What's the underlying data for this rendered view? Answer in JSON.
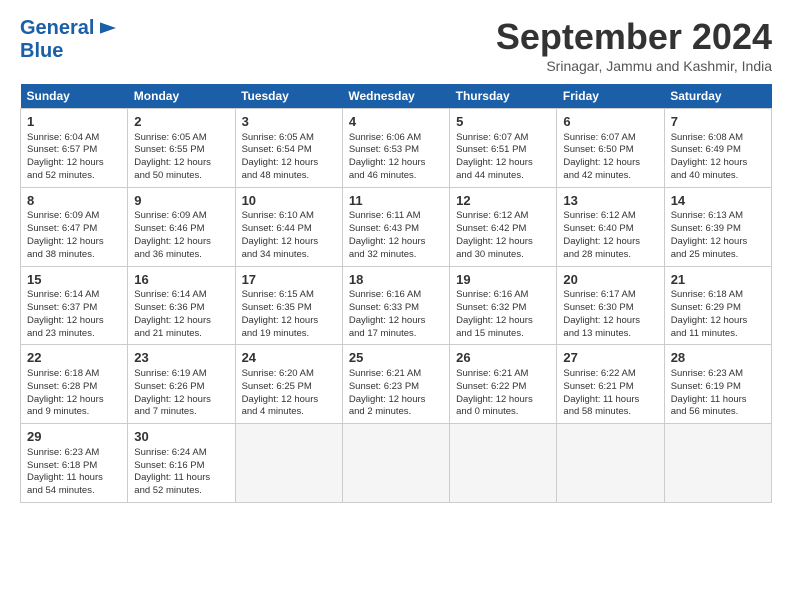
{
  "logo": {
    "line1": "General",
    "line2": "Blue"
  },
  "title": "September 2024",
  "subtitle": "Srinagar, Jammu and Kashmir, India",
  "days_header": [
    "Sunday",
    "Monday",
    "Tuesday",
    "Wednesday",
    "Thursday",
    "Friday",
    "Saturday"
  ],
  "weeks": [
    [
      {
        "num": "1",
        "rise": "6:04 AM",
        "set": "6:57 PM",
        "daylight": "12 hours and 52 minutes."
      },
      {
        "num": "2",
        "rise": "6:05 AM",
        "set": "6:55 PM",
        "daylight": "12 hours and 50 minutes."
      },
      {
        "num": "3",
        "rise": "6:05 AM",
        "set": "6:54 PM",
        "daylight": "12 hours and 48 minutes."
      },
      {
        "num": "4",
        "rise": "6:06 AM",
        "set": "6:53 PM",
        "daylight": "12 hours and 46 minutes."
      },
      {
        "num": "5",
        "rise": "6:07 AM",
        "set": "6:51 PM",
        "daylight": "12 hours and 44 minutes."
      },
      {
        "num": "6",
        "rise": "6:07 AM",
        "set": "6:50 PM",
        "daylight": "12 hours and 42 minutes."
      },
      {
        "num": "7",
        "rise": "6:08 AM",
        "set": "6:49 PM",
        "daylight": "12 hours and 40 minutes."
      }
    ],
    [
      {
        "num": "8",
        "rise": "6:09 AM",
        "set": "6:47 PM",
        "daylight": "12 hours and 38 minutes."
      },
      {
        "num": "9",
        "rise": "6:09 AM",
        "set": "6:46 PM",
        "daylight": "12 hours and 36 minutes."
      },
      {
        "num": "10",
        "rise": "6:10 AM",
        "set": "6:44 PM",
        "daylight": "12 hours and 34 minutes."
      },
      {
        "num": "11",
        "rise": "6:11 AM",
        "set": "6:43 PM",
        "daylight": "12 hours and 32 minutes."
      },
      {
        "num": "12",
        "rise": "6:12 AM",
        "set": "6:42 PM",
        "daylight": "12 hours and 30 minutes."
      },
      {
        "num": "13",
        "rise": "6:12 AM",
        "set": "6:40 PM",
        "daylight": "12 hours and 28 minutes."
      },
      {
        "num": "14",
        "rise": "6:13 AM",
        "set": "6:39 PM",
        "daylight": "12 hours and 25 minutes."
      }
    ],
    [
      {
        "num": "15",
        "rise": "6:14 AM",
        "set": "6:37 PM",
        "daylight": "12 hours and 23 minutes."
      },
      {
        "num": "16",
        "rise": "6:14 AM",
        "set": "6:36 PM",
        "daylight": "12 hours and 21 minutes."
      },
      {
        "num": "17",
        "rise": "6:15 AM",
        "set": "6:35 PM",
        "daylight": "12 hours and 19 minutes."
      },
      {
        "num": "18",
        "rise": "6:16 AM",
        "set": "6:33 PM",
        "daylight": "12 hours and 17 minutes."
      },
      {
        "num": "19",
        "rise": "6:16 AM",
        "set": "6:32 PM",
        "daylight": "12 hours and 15 minutes."
      },
      {
        "num": "20",
        "rise": "6:17 AM",
        "set": "6:30 PM",
        "daylight": "12 hours and 13 minutes."
      },
      {
        "num": "21",
        "rise": "6:18 AM",
        "set": "6:29 PM",
        "daylight": "12 hours and 11 minutes."
      }
    ],
    [
      {
        "num": "22",
        "rise": "6:18 AM",
        "set": "6:28 PM",
        "daylight": "12 hours and 9 minutes."
      },
      {
        "num": "23",
        "rise": "6:19 AM",
        "set": "6:26 PM",
        "daylight": "12 hours and 7 minutes."
      },
      {
        "num": "24",
        "rise": "6:20 AM",
        "set": "6:25 PM",
        "daylight": "12 hours and 4 minutes."
      },
      {
        "num": "25",
        "rise": "6:21 AM",
        "set": "6:23 PM",
        "daylight": "12 hours and 2 minutes."
      },
      {
        "num": "26",
        "rise": "6:21 AM",
        "set": "6:22 PM",
        "daylight": "12 hours and 0 minutes."
      },
      {
        "num": "27",
        "rise": "6:22 AM",
        "set": "6:21 PM",
        "daylight": "11 hours and 58 minutes."
      },
      {
        "num": "28",
        "rise": "6:23 AM",
        "set": "6:19 PM",
        "daylight": "11 hours and 56 minutes."
      }
    ],
    [
      {
        "num": "29",
        "rise": "6:23 AM",
        "set": "6:18 PM",
        "daylight": "11 hours and 54 minutes."
      },
      {
        "num": "30",
        "rise": "6:24 AM",
        "set": "6:16 PM",
        "daylight": "11 hours and 52 minutes."
      },
      null,
      null,
      null,
      null,
      null
    ]
  ]
}
